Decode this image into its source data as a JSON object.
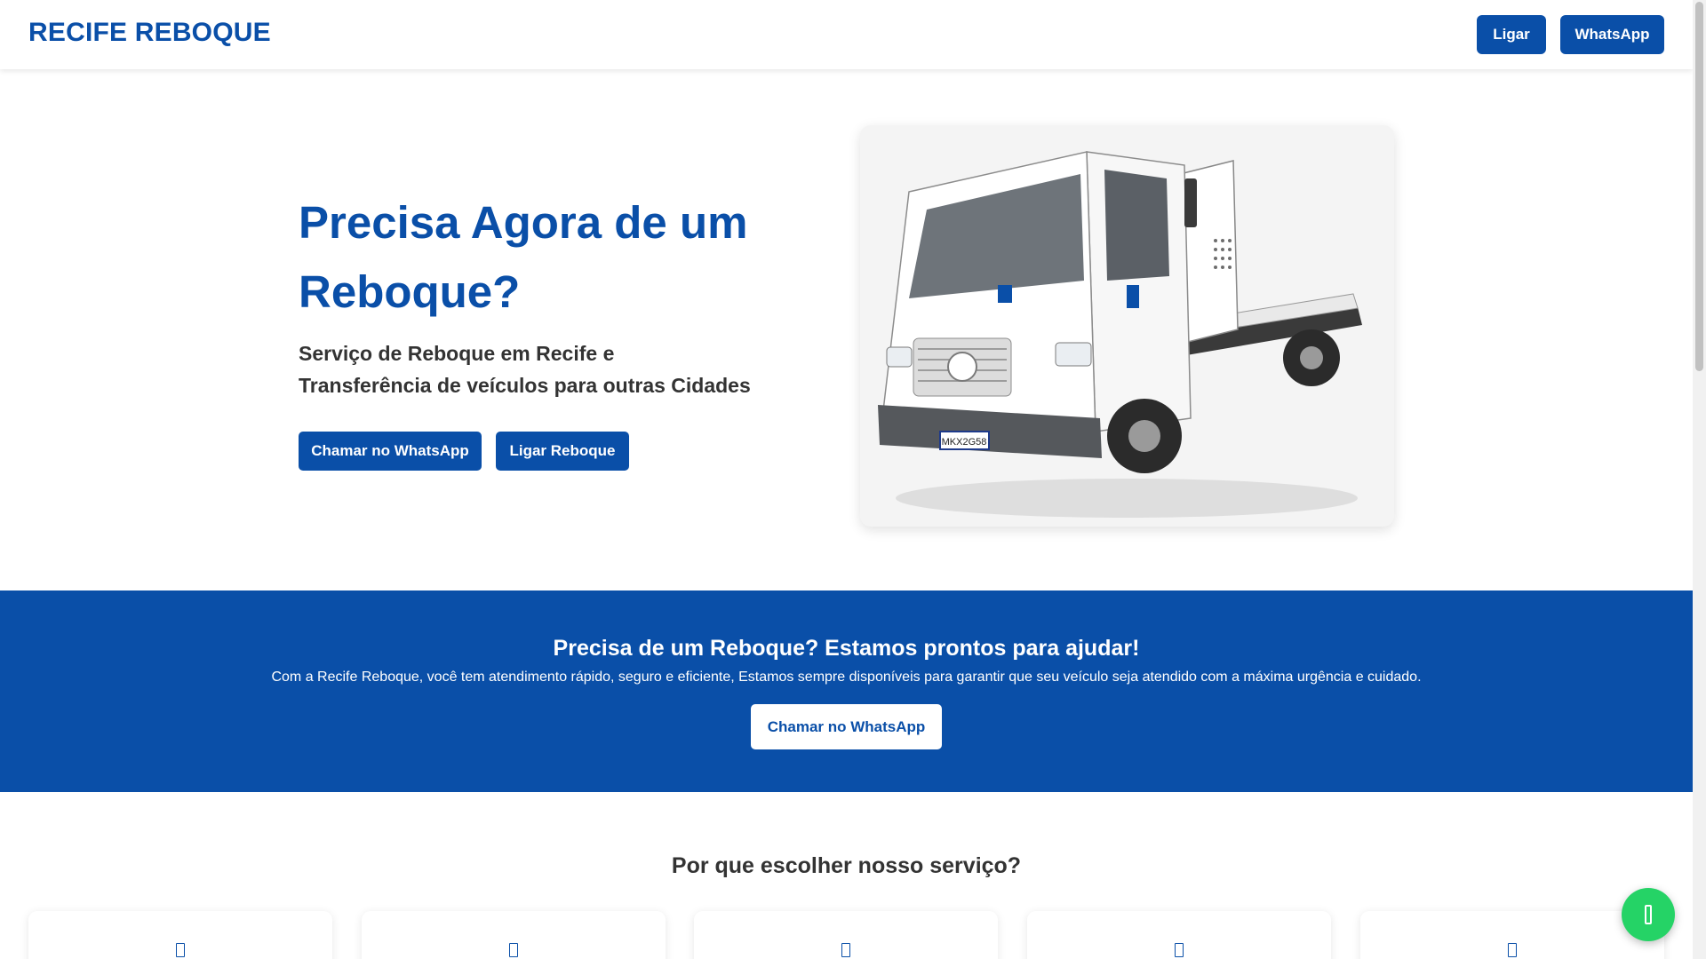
{
  "header": {
    "logo": "RECIFE REBOQUE",
    "call_label": "Ligar",
    "whatsapp_label": "WhatsApp"
  },
  "hero": {
    "title": "Precisa Agora de um Reboque?",
    "subtitle_line1": "Serviço de Reboque em Recife e",
    "subtitle_line2": "Transferência de veículos para outras Cidades",
    "whatsapp_button": "Chamar no WhatsApp",
    "call_button": "Ligar Reboque",
    "image_plate": "MKX2G58"
  },
  "band": {
    "title": "Precisa de um Reboque? Estamos prontos para ajudar!",
    "text": "Com a Recife Reboque, você tem atendimento rápido, seguro e eficiente, Estamos sempre disponíveis para garantir que seu veículo seja atendido com a máxima urgência e cuidado.",
    "button": "Chamar no WhatsApp"
  },
  "why": {
    "title": "Por que escolher nosso serviço?"
  },
  "icons": {
    "card": "feature-icon",
    "fab": "whatsapp-icon"
  },
  "colors": {
    "brand_blue": "#0a4fa8",
    "whatsapp_green": "#25d366"
  }
}
